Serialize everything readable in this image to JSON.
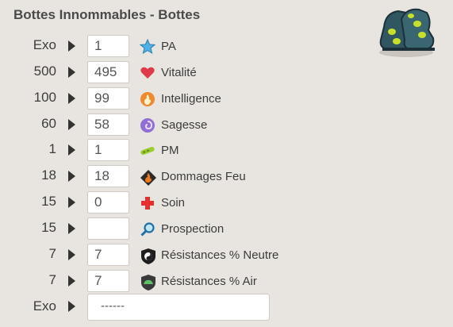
{
  "title": "Bottes Innommables - Bottes",
  "rows": [
    {
      "required": "Exo",
      "value": "1",
      "stat": "PA",
      "icon": "pa-star-icon"
    },
    {
      "required": "500",
      "value": "495",
      "stat": "Vitalité",
      "icon": "heart-icon"
    },
    {
      "required": "100",
      "value": "99",
      "stat": "Intelligence",
      "icon": "fire-intelligence-icon"
    },
    {
      "required": "60",
      "value": "58",
      "stat": "Sagesse",
      "icon": "wisdom-swirl-icon"
    },
    {
      "required": "1",
      "value": "1",
      "stat": "PM",
      "icon": "pm-boot-icon"
    },
    {
      "required": "18",
      "value": "18",
      "stat": "Dommages Feu",
      "icon": "fire-damage-icon"
    },
    {
      "required": "15",
      "value": "0",
      "stat": "Soin",
      "icon": "heal-cross-icon"
    },
    {
      "required": "15",
      "value": "",
      "stat": "Prospection",
      "icon": "prospection-magnifier-icon"
    },
    {
      "required": "7",
      "value": "7",
      "stat": "Résistances % Neutre",
      "icon": "neutral-resist-icon"
    },
    {
      "required": "7",
      "value": "7",
      "stat": "Résistances % Air",
      "icon": "air-resist-icon"
    }
  ],
  "exo_row": {
    "required": "Exo",
    "value": "------"
  }
}
